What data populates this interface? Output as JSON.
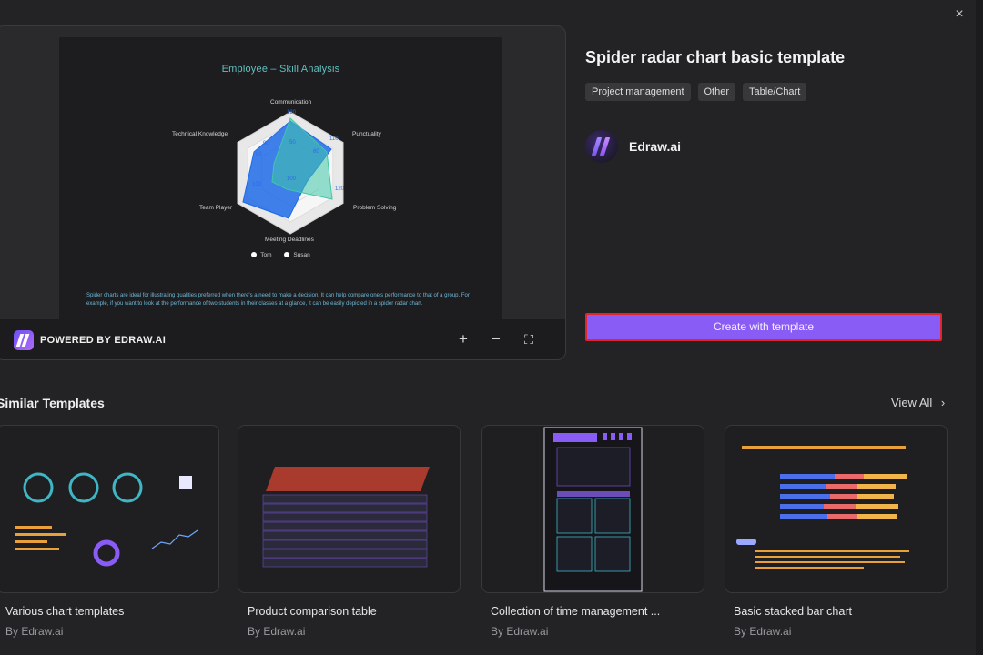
{
  "close_label": "×",
  "preview": {
    "chart_title": "Employee – Skill Analysis",
    "axes": [
      "Communication",
      "Punctuality",
      "Problem Solving",
      "Meeting Deadlines",
      "Team Player",
      "Technical Knowledge"
    ],
    "ticks": [
      "120",
      "50",
      "60",
      "110",
      "120",
      "100",
      "100",
      "90",
      "80"
    ],
    "legend": [
      "Tom",
      "Susan"
    ],
    "description": "Spider charts are ideal for illustrating qualities preferred when there's a need to make a decision. It can help compare one's performance to that of a group. For example, if you want to look at the performance of two students in their classes at a glance, it can be easily depicted in a spider radar chart.",
    "powered_by": "POWERED BY EDRAW.AI",
    "tools": {
      "zoom_in": "+",
      "zoom_out": "−",
      "fullscreen": "⛶"
    }
  },
  "template": {
    "title": "Spider radar chart basic template",
    "tags": [
      "Project management",
      "Other",
      "Table/Chart"
    ],
    "author": "Edraw.ai",
    "create_label": "Create with template"
  },
  "similar": {
    "title": "Similar Templates",
    "view_all": "View All",
    "view_all_icon": "chevron-right-icon",
    "cards": [
      {
        "title": "Various chart templates",
        "by": "By Edraw.ai"
      },
      {
        "title": "Product comparison table",
        "by": "By Edraw.ai"
      },
      {
        "title": "Collection of time management ...",
        "by": "By Edraw.ai"
      },
      {
        "title": "Basic stacked bar chart",
        "by": "By Edraw.ai"
      }
    ]
  },
  "colors": {
    "accent": "#8a5cf6",
    "highlight_border": "#e0262c",
    "teal": "#5fc0c0",
    "blue": "#2e6be6"
  }
}
